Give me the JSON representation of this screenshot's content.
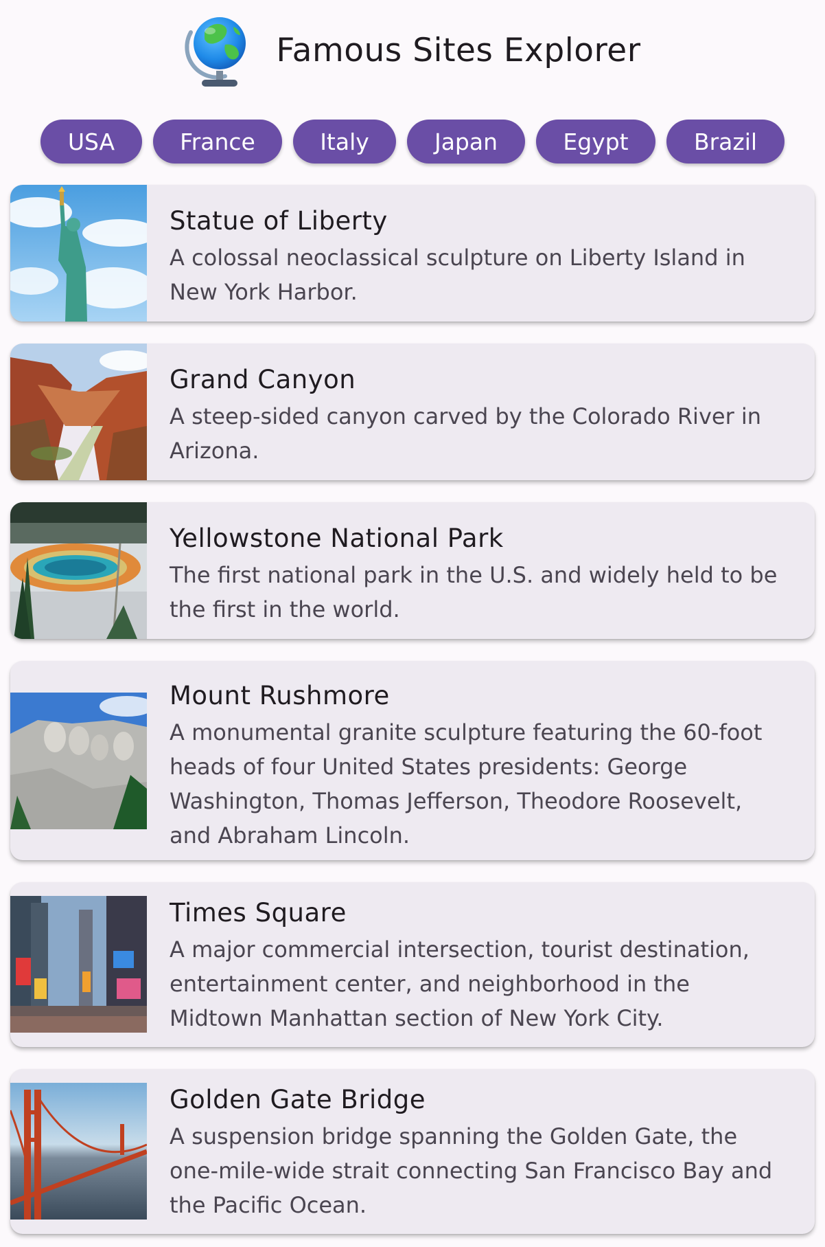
{
  "header": {
    "title": "Famous Sites Explorer",
    "icon": "globe-icon"
  },
  "countries": [
    {
      "label": "USA"
    },
    {
      "label": "France"
    },
    {
      "label": "Italy"
    },
    {
      "label": "Japan"
    },
    {
      "label": "Egypt"
    },
    {
      "label": "Brazil"
    }
  ],
  "sites": [
    {
      "title": "Statue of Liberty",
      "description": "A colossal neoclassical sculpture on Liberty Island in New York Harbor.",
      "image": "statue-of-liberty-photo"
    },
    {
      "title": "Grand Canyon",
      "description": "A steep-sided canyon carved by the Colorado River in Arizona.",
      "image": "grand-canyon-photo"
    },
    {
      "title": "Yellowstone National Park",
      "description": "The first national park in the U.S. and widely held to be the first in the world.",
      "image": "yellowstone-photo"
    },
    {
      "title": "Mount Rushmore",
      "description": "A monumental granite sculpture featuring the 60-foot heads of four United States presidents: George Washington, Thomas Jefferson, Theodore Roosevelt, and Abraham Lincoln.",
      "image": "mount-rushmore-photo"
    },
    {
      "title": "Times Square",
      "description": "A major commercial intersection, tourist destination, entertainment center, and neighborhood in the Midtown Manhattan section of New York City.",
      "image": "times-square-photo"
    },
    {
      "title": "Golden Gate Bridge",
      "description": "A suspension bridge spanning the Golden Gate, the one-mile-wide strait connecting San Francisco Bay and the Pacific Ocean.",
      "image": "golden-gate-bridge-photo"
    }
  ],
  "colors": {
    "accent": "#6a4ea6",
    "card_background": "#eeeaf1",
    "page_background": "#fcf9fc"
  }
}
